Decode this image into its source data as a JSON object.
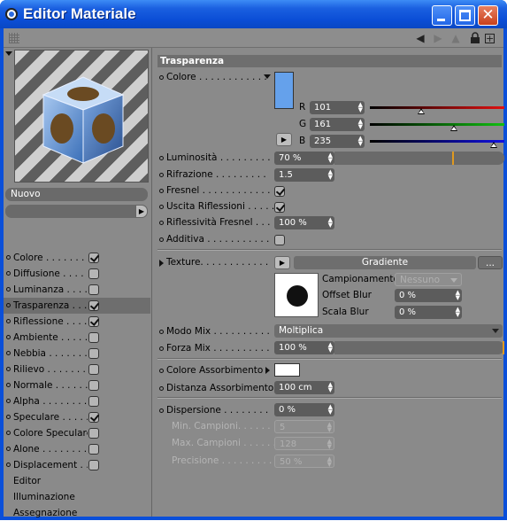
{
  "window": {
    "title": "Editor Materiale"
  },
  "left": {
    "preset_name": "Nuovo",
    "channels": [
      {
        "label": "Colore",
        "dots": " . . . . . . . .",
        "checked": true
      },
      {
        "label": "Diffusione",
        "dots": " . . . . . . .",
        "checked": false
      },
      {
        "label": "Luminanza",
        "dots": " . . . . . .",
        "checked": false
      },
      {
        "label": "Trasparenza",
        "dots": " . . . .",
        "checked": true,
        "selected": true
      },
      {
        "label": "Riflessione",
        "dots": " . . . . .",
        "checked": true
      },
      {
        "label": "Ambiente",
        "dots": " . . . . . . .",
        "checked": false
      },
      {
        "label": "Nebbia",
        "dots": " . . . . . . . .",
        "checked": false
      },
      {
        "label": "Rilievo",
        "dots": " . . . . . . . .",
        "checked": false
      },
      {
        "label": "Normale",
        "dots": " . . . . . . .",
        "checked": false
      },
      {
        "label": "Alpha",
        "dots": " . . . . . . . . .",
        "checked": false
      },
      {
        "label": "Speculare",
        "dots": " . . . . . .",
        "checked": true
      },
      {
        "label": "Colore Speculare",
        "dots": "",
        "checked": false
      },
      {
        "label": "Alone",
        "dots": " . . . . . . . . .",
        "checked": false
      },
      {
        "label": "Displacement",
        "dots": " . . .",
        "checked": false
      }
    ],
    "extras": [
      "Editor",
      "Illuminazione",
      "Assegnazione"
    ]
  },
  "section": {
    "title": "Trasparenza"
  },
  "colore": {
    "label": "Colore . . . . . . . . . . . .",
    "swatch": "#65a1eb",
    "r_label": "R",
    "g_label": "G",
    "b_label": "B",
    "r": "101",
    "g": "161",
    "b": "235"
  },
  "luminosita": {
    "label": "Luminosità . . . . . . . . .",
    "value": "70 %",
    "fraction": 0.7
  },
  "rifrazione": {
    "label": "Rifrazione . . . . . . . . .",
    "value": "1.5"
  },
  "fresnel": {
    "label": "Fresnel . . . . . . . . . . . .",
    "checked": true
  },
  "uscita": {
    "label": "Uscita Riflessioni . . . . .",
    "checked": true
  },
  "riflessivita": {
    "label": "Riflessività Fresnel . . .",
    "value": "100 %"
  },
  "additiva": {
    "label": "Additiva . . . . . . . . . . .",
    "checked": false
  },
  "texture": {
    "label": "Texture. . . . . . . . . . . .",
    "name": "Gradiente",
    "more": "...",
    "campionamento_label": "Campionamento",
    "campionamento": "Nessuno",
    "offset_label": "Offset Blur",
    "offset": "0 %",
    "scala_label": "Scala Blur",
    "scala": "0 %"
  },
  "modo_mix": {
    "label": "Modo Mix . . . . . . . . . .",
    "value": "Moltiplica"
  },
  "forza_mix": {
    "label": "Forza Mix . . . . . . . . . .",
    "value": "100 %",
    "fraction": 1.0
  },
  "assorbimento": {
    "colore_label": "Colore Assorbimento",
    "colore": "#ffffff",
    "distanza_label": "Distanza Assorbimento",
    "distanza": "100 cm"
  },
  "dispersione": {
    "label": "Dispersione . . . . . . . .",
    "value": "0 %",
    "min_label": "Min. Campioni. . . . . . . .",
    "min": "5",
    "max_label": "Max. Campioni . . . . . . .",
    "max": "128",
    "prec_label": "Precisione . . . . . . . . .",
    "prec": "50 %"
  },
  "colors": {
    "red_track": "#e01010",
    "green_track": "#10c010",
    "blue_track": "#1010e0"
  }
}
